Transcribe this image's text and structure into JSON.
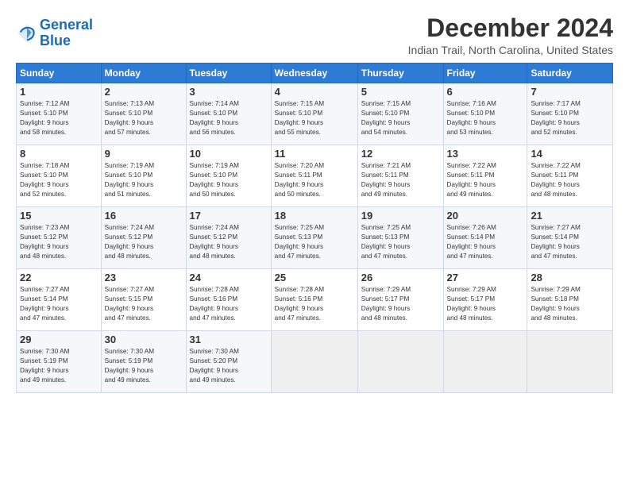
{
  "logo": {
    "line1": "General",
    "line2": "Blue"
  },
  "title": "December 2024",
  "location": "Indian Trail, North Carolina, United States",
  "header": {
    "days": [
      "Sunday",
      "Monday",
      "Tuesday",
      "Wednesday",
      "Thursday",
      "Friday",
      "Saturday"
    ]
  },
  "weeks": [
    [
      {
        "day": "1",
        "sunrise": "7:12 AM",
        "sunset": "5:10 PM",
        "daylight": "9 hours and 58 minutes."
      },
      {
        "day": "2",
        "sunrise": "7:13 AM",
        "sunset": "5:10 PM",
        "daylight": "9 hours and 57 minutes."
      },
      {
        "day": "3",
        "sunrise": "7:14 AM",
        "sunset": "5:10 PM",
        "daylight": "9 hours and 56 minutes."
      },
      {
        "day": "4",
        "sunrise": "7:15 AM",
        "sunset": "5:10 PM",
        "daylight": "9 hours and 55 minutes."
      },
      {
        "day": "5",
        "sunrise": "7:15 AM",
        "sunset": "5:10 PM",
        "daylight": "9 hours and 54 minutes."
      },
      {
        "day": "6",
        "sunrise": "7:16 AM",
        "sunset": "5:10 PM",
        "daylight": "9 hours and 53 minutes."
      },
      {
        "day": "7",
        "sunrise": "7:17 AM",
        "sunset": "5:10 PM",
        "daylight": "9 hours and 52 minutes."
      }
    ],
    [
      {
        "day": "8",
        "sunrise": "7:18 AM",
        "sunset": "5:10 PM",
        "daylight": "9 hours and 52 minutes."
      },
      {
        "day": "9",
        "sunrise": "7:19 AM",
        "sunset": "5:10 PM",
        "daylight": "9 hours and 51 minutes."
      },
      {
        "day": "10",
        "sunrise": "7:19 AM",
        "sunset": "5:10 PM",
        "daylight": "9 hours and 50 minutes."
      },
      {
        "day": "11",
        "sunrise": "7:20 AM",
        "sunset": "5:11 PM",
        "daylight": "9 hours and 50 minutes."
      },
      {
        "day": "12",
        "sunrise": "7:21 AM",
        "sunset": "5:11 PM",
        "daylight": "9 hours and 49 minutes."
      },
      {
        "day": "13",
        "sunrise": "7:22 AM",
        "sunset": "5:11 PM",
        "daylight": "9 hours and 49 minutes."
      },
      {
        "day": "14",
        "sunrise": "7:22 AM",
        "sunset": "5:11 PM",
        "daylight": "9 hours and 48 minutes."
      }
    ],
    [
      {
        "day": "15",
        "sunrise": "7:23 AM",
        "sunset": "5:12 PM",
        "daylight": "9 hours and 48 minutes."
      },
      {
        "day": "16",
        "sunrise": "7:24 AM",
        "sunset": "5:12 PM",
        "daylight": "9 hours and 48 minutes."
      },
      {
        "day": "17",
        "sunrise": "7:24 AM",
        "sunset": "5:12 PM",
        "daylight": "9 hours and 48 minutes."
      },
      {
        "day": "18",
        "sunrise": "7:25 AM",
        "sunset": "5:13 PM",
        "daylight": "9 hours and 47 minutes."
      },
      {
        "day": "19",
        "sunrise": "7:25 AM",
        "sunset": "5:13 PM",
        "daylight": "9 hours and 47 minutes."
      },
      {
        "day": "20",
        "sunrise": "7:26 AM",
        "sunset": "5:14 PM",
        "daylight": "9 hours and 47 minutes."
      },
      {
        "day": "21",
        "sunrise": "7:27 AM",
        "sunset": "5:14 PM",
        "daylight": "9 hours and 47 minutes."
      }
    ],
    [
      {
        "day": "22",
        "sunrise": "7:27 AM",
        "sunset": "5:14 PM",
        "daylight": "9 hours and 47 minutes."
      },
      {
        "day": "23",
        "sunrise": "7:27 AM",
        "sunset": "5:15 PM",
        "daylight": "9 hours and 47 minutes."
      },
      {
        "day": "24",
        "sunrise": "7:28 AM",
        "sunset": "5:16 PM",
        "daylight": "9 hours and 47 minutes."
      },
      {
        "day": "25",
        "sunrise": "7:28 AM",
        "sunset": "5:16 PM",
        "daylight": "9 hours and 47 minutes."
      },
      {
        "day": "26",
        "sunrise": "7:29 AM",
        "sunset": "5:17 PM",
        "daylight": "9 hours and 48 minutes."
      },
      {
        "day": "27",
        "sunrise": "7:29 AM",
        "sunset": "5:17 PM",
        "daylight": "9 hours and 48 minutes."
      },
      {
        "day": "28",
        "sunrise": "7:29 AM",
        "sunset": "5:18 PM",
        "daylight": "9 hours and 48 minutes."
      }
    ],
    [
      {
        "day": "29",
        "sunrise": "7:30 AM",
        "sunset": "5:19 PM",
        "daylight": "9 hours and 49 minutes."
      },
      {
        "day": "30",
        "sunrise": "7:30 AM",
        "sunset": "5:19 PM",
        "daylight": "9 hours and 49 minutes."
      },
      {
        "day": "31",
        "sunrise": "7:30 AM",
        "sunset": "5:20 PM",
        "daylight": "9 hours and 49 minutes."
      },
      null,
      null,
      null,
      null
    ]
  ]
}
